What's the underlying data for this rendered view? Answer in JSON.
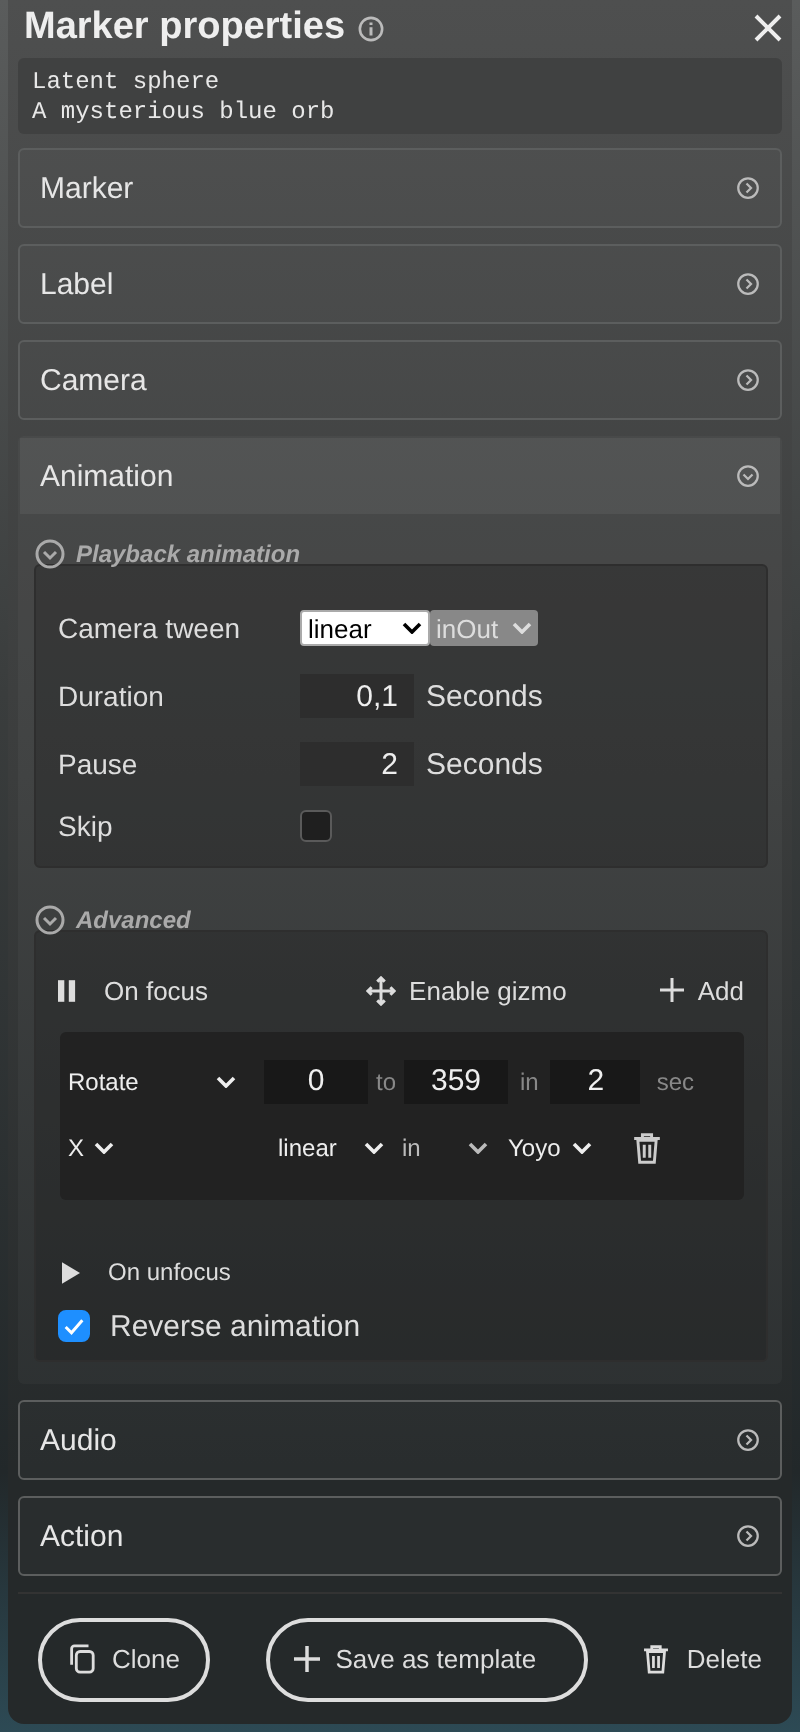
{
  "title": "Marker properties",
  "description": {
    "value": "Latent sphere\nA mysterious blue orb"
  },
  "sections": [
    {
      "label": "Marker",
      "expanded": false
    },
    {
      "label": "Label",
      "expanded": false
    },
    {
      "label": "Camera",
      "expanded": false
    },
    {
      "label": "Animation",
      "expanded": true
    },
    {
      "label": "Audio",
      "expanded": false
    },
    {
      "label": "Action",
      "expanded": false
    }
  ],
  "animation": {
    "playback": {
      "title": "Playback animation",
      "expanded": true,
      "camera_tween": {
        "label": "Camera tween",
        "easing": "linear",
        "direction": "inOut",
        "direction_disabled": true
      },
      "duration": {
        "label": "Duration",
        "value": "0,1",
        "unit": "Seconds"
      },
      "pause": {
        "label": "Pause",
        "value": "2",
        "unit": "Seconds"
      },
      "skip": {
        "label": "Skip",
        "checked": false
      }
    },
    "advanced": {
      "title": "Advanced",
      "expanded": true,
      "on_focus": {
        "label": "On focus"
      },
      "gizmo_button": "Enable gizmo",
      "add_button": "Add",
      "tween": {
        "property": "Rotate",
        "from": "0",
        "to_label": "to",
        "to": "359",
        "in_label": "in",
        "duration": "2",
        "unit": "sec",
        "axis": "X",
        "easing": "linear",
        "direction": "in",
        "loop": "Yoyo"
      },
      "on_unfocus": {
        "label": "On unfocus"
      },
      "reverse": {
        "label": "Reverse animation",
        "checked": true
      }
    }
  },
  "footer": {
    "clone": "Clone",
    "save_template": "Save as template",
    "delete": "Delete"
  }
}
